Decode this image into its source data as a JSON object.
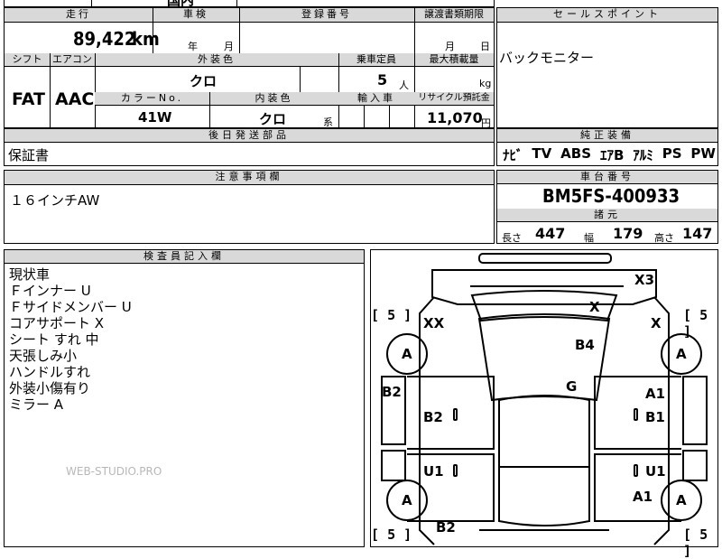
{
  "top_partial": {
    "model_text": "国内"
  },
  "mileage": {
    "label": "走行",
    "value": "89,422",
    "unit": "km"
  },
  "inspection": {
    "label": "車検",
    "year": "年",
    "month": "月"
  },
  "registration": {
    "label": "登録番号"
  },
  "transfer": {
    "label": "譲渡書類期限",
    "month": "月",
    "day": "日"
  },
  "sales_point": {
    "label": "セールスポイント",
    "text": "バックモニター"
  },
  "shift": {
    "label": "シフト",
    "value": "FAT"
  },
  "aircon": {
    "label": "エアコン",
    "value": "AAC"
  },
  "exterior": {
    "label": "外装色",
    "value": "クロ"
  },
  "capacity": {
    "label": "乗車定員",
    "value": "5",
    "unit": "人"
  },
  "max_load": {
    "label": "最大積載量",
    "unit": "kg"
  },
  "color_no": {
    "label": "カラーNo.",
    "value": "41W"
  },
  "interior": {
    "label": "内装色",
    "value": "クロ",
    "suffix": "系"
  },
  "import": {
    "label": "輸入車"
  },
  "recycle": {
    "label": "リサイクル預託金",
    "value": "11,070",
    "unit": "円"
  },
  "later_parts": {
    "label": "後日発送部品",
    "value": "保証書"
  },
  "equipment": {
    "label": "純正装備",
    "items": [
      "ﾅﾋﾞ",
      "TV",
      "ABS",
      "ｴｱB",
      "ｱﾙﾐ",
      "PS",
      "PW"
    ]
  },
  "notes": {
    "label": "注意事項欄",
    "value": "１６インチAW"
  },
  "chassis": {
    "label": "車台番号",
    "value": "BM5FS-400933"
  },
  "specs": {
    "label": "諸元",
    "length_label": "長さ",
    "length": "447",
    "width_label": "幅",
    "width": "179",
    "height_label": "高さ",
    "height": "147"
  },
  "inspector": {
    "label": "検査員記入欄",
    "lines": [
      "現状車",
      "Ｆインナー U",
      "Ｆサイドメンバー U",
      "コアサポート X",
      "シート すれ 中",
      "天張しみ小",
      "ハンドルすれ",
      "外装小傷有り",
      "ミラー A"
    ]
  },
  "watermark": "WEB-STUDIO.PRO",
  "damage": {
    "x3": "X3",
    "x_roof": "X",
    "xx": "XX",
    "x_right": "X",
    "b4": "B4",
    "g": "G",
    "a_fl": "A",
    "a_fr": "A",
    "a_rl": "A",
    "a_rr": "A",
    "b2_left": "B2",
    "b2_door": "B2",
    "a1_right": "A1",
    "b1_right": "B1",
    "u1_left": "U1",
    "u1_right": "U1",
    "a1_rear": "A1",
    "b2_bottom": "B2",
    "tire_fl": "5",
    "tire_fr": "5",
    "tire_rl": "5",
    "tire_rr": "5"
  }
}
